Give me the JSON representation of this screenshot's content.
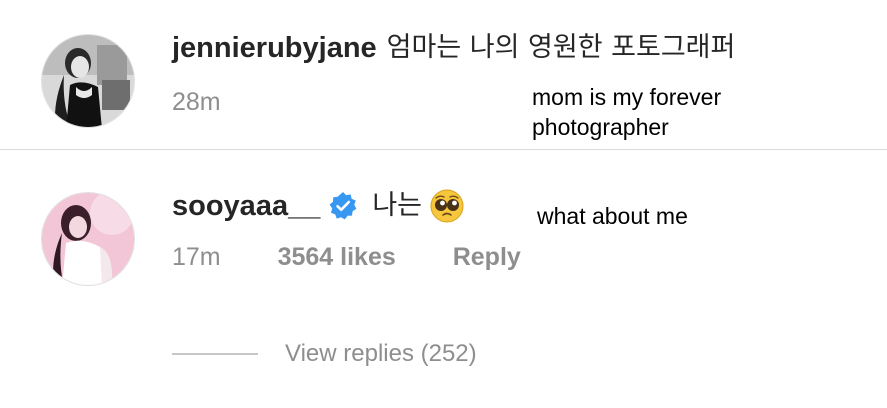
{
  "comments": [
    {
      "username": "jennierubyjane",
      "text": "엄마는 나의 영원한 포토그래퍼",
      "time": "28m",
      "translation": "mom is my forever photographer"
    },
    {
      "username": "sooyaaa__",
      "verified": true,
      "text": "나는",
      "emoji": "pleading-face",
      "time": "17m",
      "likes": "3564 likes",
      "reply": "Reply",
      "translation": "what about me",
      "view_replies": "View replies (252)"
    }
  ],
  "colors": {
    "verified": "#3897f0",
    "secondary_text": "#8e8e8e",
    "primary_text": "#262626",
    "divider": "#dbdbdb"
  },
  "icons": {
    "verified": "verified-badge-icon",
    "emoji": "pleading-face-emoji"
  }
}
